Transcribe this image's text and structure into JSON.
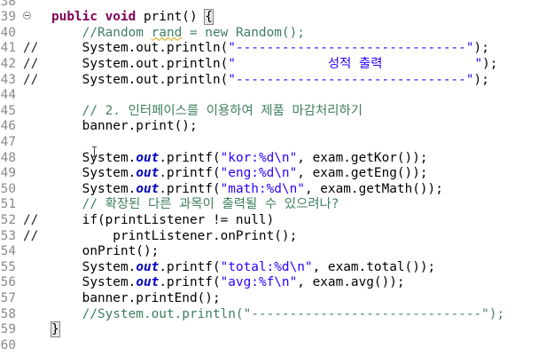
{
  "editor": {
    "lines": [
      {
        "num": "38",
        "mark": "",
        "segments": []
      },
      {
        "num": "39",
        "mark": "",
        "segments": [
          {
            "t": "public void ",
            "c": "kw"
          },
          {
            "t": "print() ",
            "c": "fn"
          },
          {
            "t": "{",
            "c": "brace-hl"
          }
        ]
      },
      {
        "num": "40",
        "mark": "",
        "segments": [
          {
            "t": "    //Random ",
            "c": "cmt"
          },
          {
            "t": "rand",
            "c": "cmt squiggle"
          },
          {
            "t": " = new Random();",
            "c": "cmt"
          }
        ]
      },
      {
        "num": "41",
        "mark": "//",
        "segments": [
          {
            "t": "    System.out.println(",
            "c": ""
          },
          {
            "t": "\"------------------------------\"",
            "c": "str"
          },
          {
            "t": ");",
            "c": ""
          }
        ]
      },
      {
        "num": "42",
        "mark": "//",
        "segments": [
          {
            "t": "    System.out.println(",
            "c": ""
          },
          {
            "t": "\"            성적 출력            \"",
            "c": "str"
          },
          {
            "t": ");",
            "c": ""
          }
        ]
      },
      {
        "num": "43",
        "mark": "//",
        "segments": [
          {
            "t": "    System.out.println(",
            "c": ""
          },
          {
            "t": "\"------------------------------\"",
            "c": "str"
          },
          {
            "t": ");",
            "c": ""
          }
        ]
      },
      {
        "num": "44",
        "mark": "",
        "segments": []
      },
      {
        "num": "45",
        "mark": "",
        "segments": [
          {
            "t": "    // 2. 인터페이스를 이용하여 제품 마감처리하기",
            "c": "cmt"
          }
        ]
      },
      {
        "num": "46",
        "mark": "",
        "segments": [
          {
            "t": "    banner.print();",
            "c": ""
          }
        ]
      },
      {
        "num": "47",
        "mark": "",
        "segments": []
      },
      {
        "num": "48",
        "mark": "",
        "segments": [
          {
            "t": "    System.",
            "c": ""
          },
          {
            "t": "out",
            "c": "fld"
          },
          {
            "t": ".printf(",
            "c": ""
          },
          {
            "t": "\"kor:%d\\n\"",
            "c": "str"
          },
          {
            "t": ", exam.getKor());",
            "c": ""
          }
        ]
      },
      {
        "num": "49",
        "mark": "",
        "segments": [
          {
            "t": "    System.",
            "c": ""
          },
          {
            "t": "out",
            "c": "fld"
          },
          {
            "t": ".printf(",
            "c": ""
          },
          {
            "t": "\"eng:%d\\n\"",
            "c": "str"
          },
          {
            "t": ", exam.getEng());",
            "c": ""
          }
        ]
      },
      {
        "num": "50",
        "mark": "",
        "segments": [
          {
            "t": "    System.",
            "c": ""
          },
          {
            "t": "out",
            "c": "fld"
          },
          {
            "t": ".printf(",
            "c": ""
          },
          {
            "t": "\"math:%d\\n\"",
            "c": "str"
          },
          {
            "t": ", exam.getMath());",
            "c": ""
          }
        ]
      },
      {
        "num": "51",
        "mark": "",
        "segments": [
          {
            "t": "    // 확장된 다른 과목이 출력될 수 있으려나?",
            "c": "cmt"
          }
        ]
      },
      {
        "num": "52",
        "mark": "//",
        "segments": [
          {
            "t": "    if(printListener != null)",
            "c": ""
          }
        ]
      },
      {
        "num": "53",
        "mark": "//",
        "segments": [
          {
            "t": "        printListener.onPrint();",
            "c": ""
          }
        ]
      },
      {
        "num": "54",
        "mark": "",
        "segments": [
          {
            "t": "    onPrint();",
            "c": ""
          }
        ]
      },
      {
        "num": "55",
        "mark": "",
        "segments": [
          {
            "t": "    System.",
            "c": ""
          },
          {
            "t": "out",
            "c": "fld"
          },
          {
            "t": ".printf(",
            "c": ""
          },
          {
            "t": "\"total:%d\\n\"",
            "c": "str"
          },
          {
            "t": ", exam.total());",
            "c": ""
          }
        ]
      },
      {
        "num": "56",
        "mark": "",
        "segments": [
          {
            "t": "    System.",
            "c": ""
          },
          {
            "t": "out",
            "c": "fld"
          },
          {
            "t": ".printf(",
            "c": ""
          },
          {
            "t": "\"avg:%f\\n\"",
            "c": "str"
          },
          {
            "t": ", exam.avg());",
            "c": ""
          }
        ]
      },
      {
        "num": "57",
        "mark": "",
        "segments": [
          {
            "t": "    banner.printEnd();",
            "c": ""
          }
        ]
      },
      {
        "num": "58",
        "mark": "",
        "segments": [
          {
            "t": "    //System.out.println(\"------------------------------\");",
            "c": "cmt"
          }
        ]
      },
      {
        "num": "59",
        "mark": "",
        "segments": [
          {
            "t": "}",
            "c": "brace-hl"
          }
        ]
      },
      {
        "num": "60",
        "mark": "",
        "segments": []
      }
    ]
  },
  "colors": {
    "keyword": "#7f0055",
    "string": "#2a00ff",
    "comment": "#3f7f5f",
    "field": "#0000c0",
    "line_number": "#8a8a8a"
  },
  "icons": {
    "fold": "fold-collapse-icon",
    "cursor": "text-cursor-icon"
  }
}
